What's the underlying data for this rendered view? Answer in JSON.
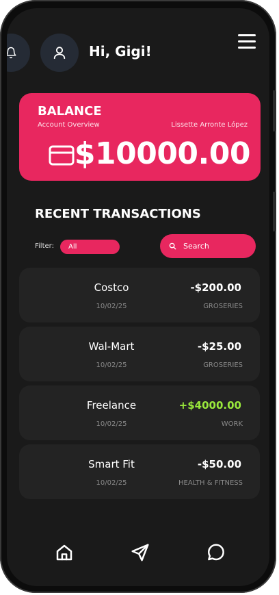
{
  "header": {
    "greeting": "Hi, Gigi!",
    "icons": [
      "bell-icon",
      "user-icon",
      "menu-icon"
    ]
  },
  "balance": {
    "title": "BALANCE",
    "subtitle": "Account Overview",
    "owner": "Lissette Arronte López",
    "amount": "$10000.00",
    "icon": "credit-card-icon"
  },
  "transactions_section": {
    "title": "RECENT TRANSACTIONS",
    "filter_label": "Filter:",
    "filter_value": "All",
    "search_placeholder": "Search"
  },
  "transactions": [
    {
      "name": "Costco",
      "date": "10/02/25",
      "amount": "-$200.00",
      "category": "GROSERIES"
    },
    {
      "name": "Wal-Mart",
      "date": "10/02/25",
      "amount": "-$25.00",
      "category": "GROSERIES"
    },
    {
      "name": "Freelance",
      "date": "10/02/25",
      "amount": "+$4000.00",
      "category": "WORK"
    },
    {
      "name": "Smart Fit",
      "date": "10/02/25",
      "amount": "-$50.00",
      "category": "HEALTH & FITNESS"
    }
  ],
  "nav": {
    "icons": [
      "home-icon",
      "send-icon",
      "chat-icon"
    ]
  },
  "colors": {
    "accent": "#e8275f",
    "positive": "#9aea3c",
    "background": "#1a1a1a",
    "card": "#232323"
  }
}
